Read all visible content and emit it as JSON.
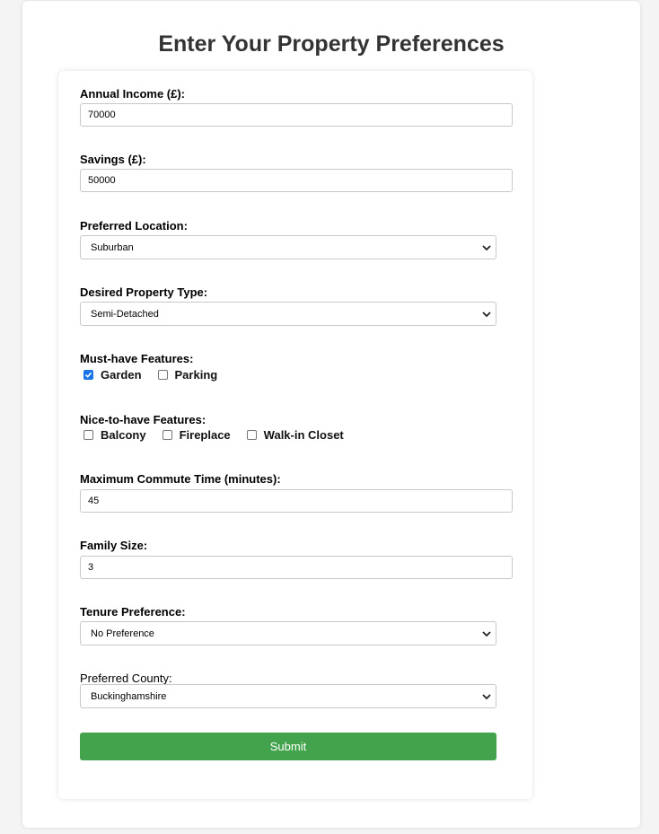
{
  "page": {
    "title": "Enter Your Property Preferences"
  },
  "form": {
    "income": {
      "label": "Annual Income (£):",
      "value": "70000"
    },
    "savings": {
      "label": "Savings (£):",
      "value": "50000"
    },
    "location": {
      "label": "Preferred Location:",
      "selected": "Suburban"
    },
    "property_type": {
      "label": "Desired Property Type:",
      "selected": "Semi-Detached"
    },
    "must_have": {
      "label": "Must-have Features:",
      "options": [
        {
          "label": "Garden",
          "checked": true
        },
        {
          "label": "Parking",
          "checked": false
        }
      ]
    },
    "nice_to_have": {
      "label": "Nice-to-have Features:",
      "options": [
        {
          "label": "Balcony",
          "checked": false
        },
        {
          "label": "Fireplace",
          "checked": false
        },
        {
          "label": "Walk-in Closet",
          "checked": false
        }
      ]
    },
    "commute": {
      "label": "Maximum Commute Time (minutes):",
      "value": "45"
    },
    "family_size": {
      "label": "Family Size:",
      "value": "3"
    },
    "tenure": {
      "label": "Tenure Preference:",
      "selected": "No Preference"
    },
    "county": {
      "label": "Preferred County:",
      "selected": "Buckinghamshire"
    },
    "submit_label": "Submit"
  },
  "colors": {
    "submit": "#43a34d",
    "checkbox_checked": "#1a73e8"
  },
  "icons": {
    "select": "chevron-down-icon",
    "checkbox": "checkmark-icon"
  }
}
